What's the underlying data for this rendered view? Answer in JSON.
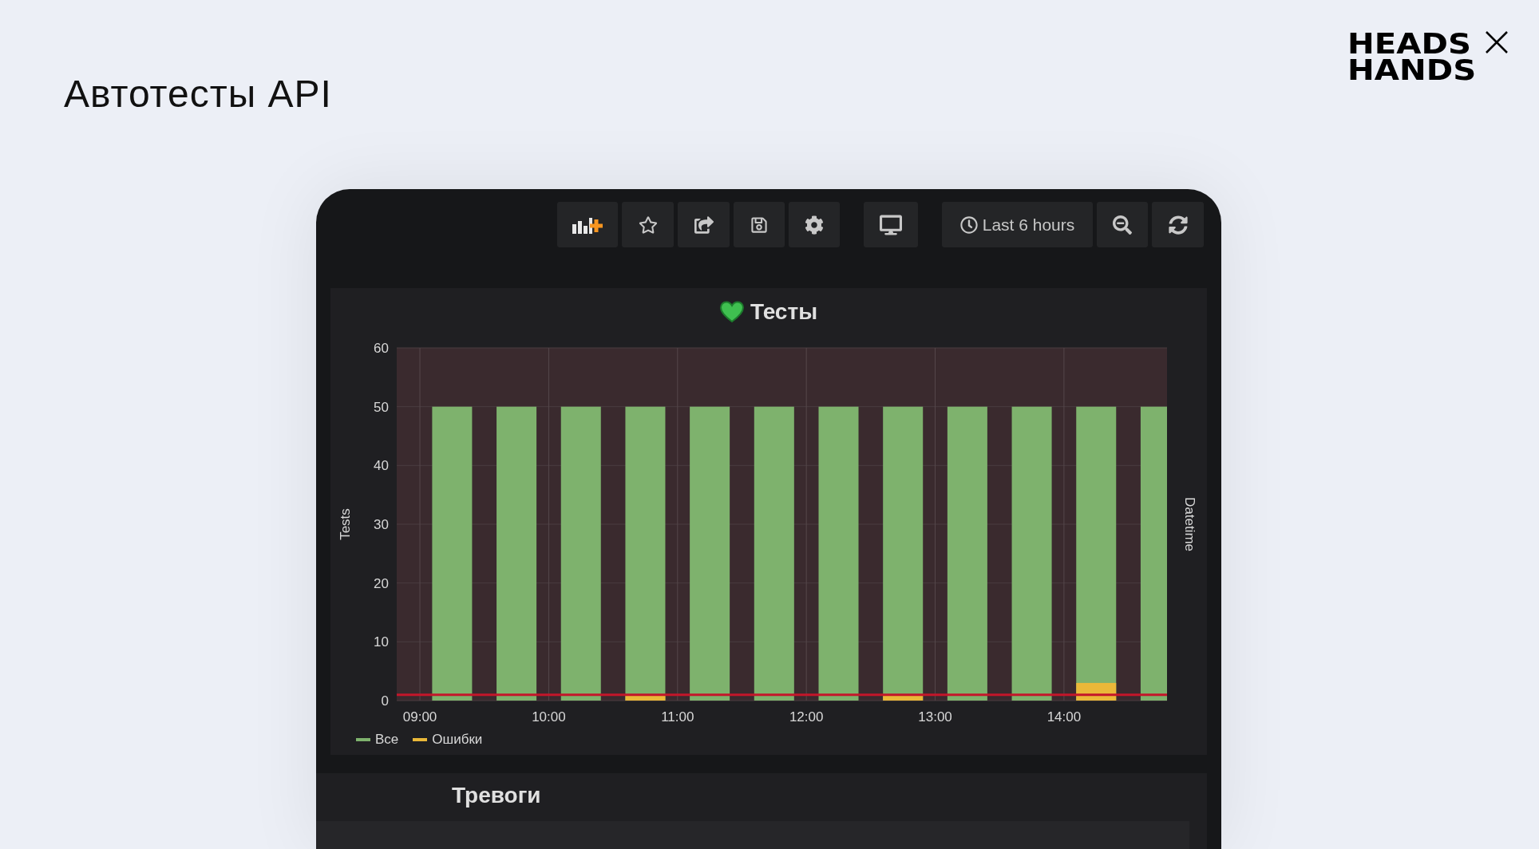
{
  "page": {
    "title": "Автотесты API"
  },
  "logo": {
    "lines": [
      "HEADS",
      "HANDS"
    ]
  },
  "toolbar": {
    "buttons": [
      {
        "kind": "add-panel"
      },
      {
        "kind": "star"
      },
      {
        "kind": "share"
      },
      {
        "kind": "save"
      },
      {
        "kind": "settings"
      },
      {
        "kind": "monitor"
      },
      {
        "kind": "time-range",
        "label": "Last 6 hours"
      },
      {
        "kind": "zoom-out"
      },
      {
        "kind": "refresh"
      }
    ]
  },
  "panel": {
    "title": "Тесты",
    "right_axis_label": "Datetime",
    "chart_data": {
      "type": "bar",
      "ylabel": "Tests",
      "x": [
        9.25,
        9.75,
        10.25,
        10.75,
        11.25,
        11.75,
        12.25,
        12.75,
        13.25,
        13.75,
        14.25,
        14.75
      ],
      "xlim": [
        8.82,
        14.8
      ],
      "ylim": [
        0,
        60
      ],
      "yticks": [
        0,
        10,
        20,
        30,
        40,
        50,
        60
      ],
      "xticks": [
        {
          "value": 9,
          "label": "09:00"
        },
        {
          "value": 10,
          "label": "10:00"
        },
        {
          "value": 11,
          "label": "11:00"
        },
        {
          "value": 12,
          "label": "12:00"
        },
        {
          "value": 13,
          "label": "13:00"
        },
        {
          "value": 14,
          "label": "14:00"
        }
      ],
      "stacked": false,
      "grid": true,
      "series": [
        {
          "name": "Все",
          "color": "#7eb26d",
          "values": [
            50,
            50,
            50,
            50,
            50,
            50,
            50,
            50,
            50,
            50,
            50,
            50
          ]
        },
        {
          "name": "Ошибки",
          "color": "#eab839",
          "values": [
            0,
            0,
            0,
            1,
            0,
            0,
            0,
            1,
            0,
            0,
            3,
            0
          ]
        }
      ],
      "ref_lines": [
        {
          "axis": "y",
          "value": 1,
          "color": "#c4162a"
        }
      ]
    }
  },
  "alerts": {
    "title": "Тревоги"
  }
}
